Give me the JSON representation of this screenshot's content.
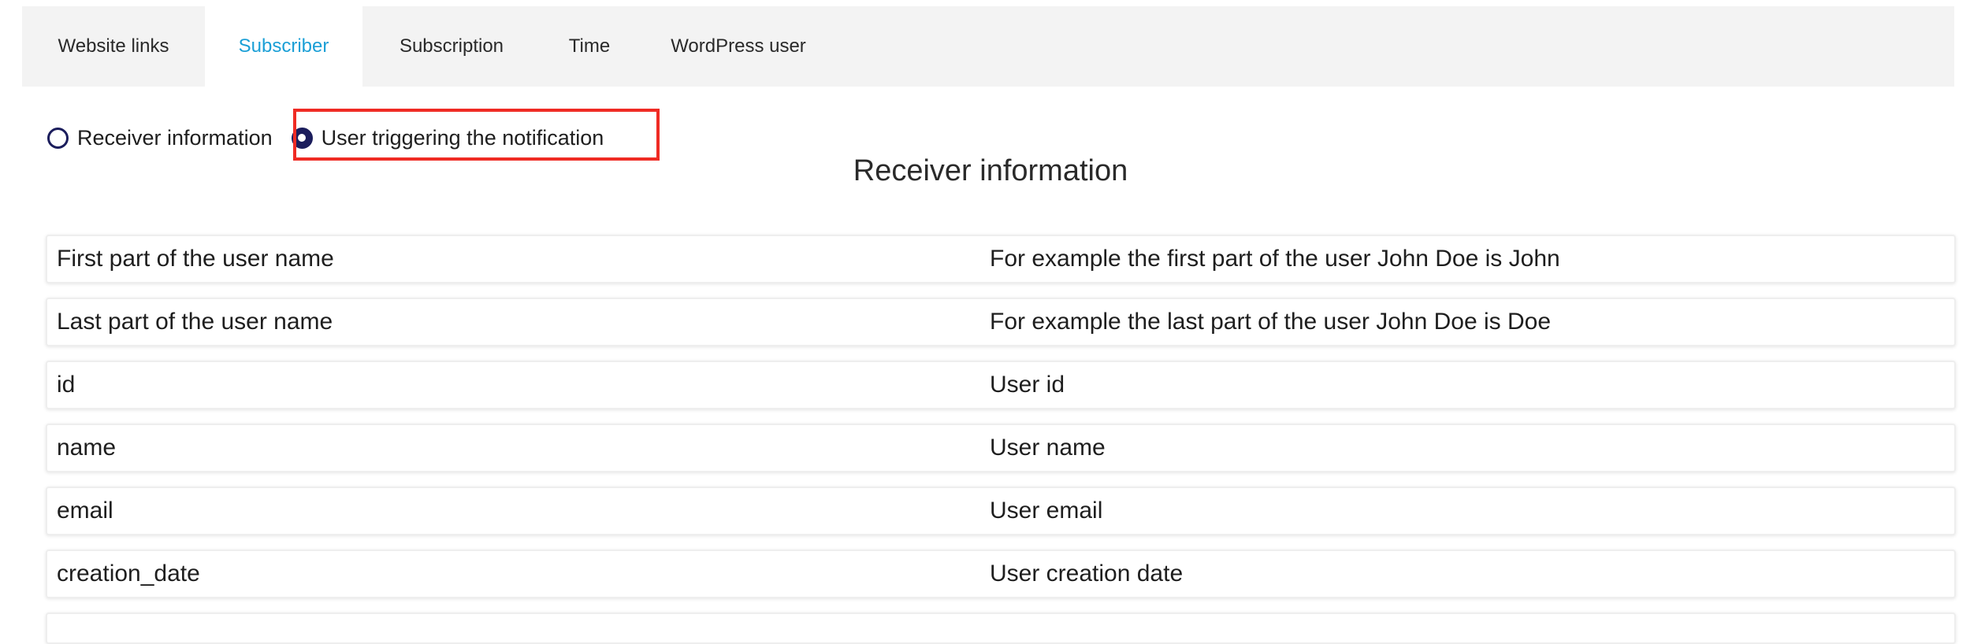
{
  "tabs": [
    {
      "label": "Website links",
      "active": false
    },
    {
      "label": "Subscriber",
      "active": true
    },
    {
      "label": "Subscription",
      "active": false
    },
    {
      "label": "Time",
      "active": false
    },
    {
      "label": "WordPress user",
      "active": false
    }
  ],
  "radio_group": {
    "options": [
      {
        "label": "Receiver information",
        "checked": false
      },
      {
        "label": "User triggering the notification",
        "checked": true
      }
    ]
  },
  "section_title": "Receiver information",
  "rows": [
    {
      "key": "First part of the user name",
      "description": "For example the first part of the user John Doe is John"
    },
    {
      "key": "Last part of the user name",
      "description": "For example the last part of the user John Doe is Doe"
    },
    {
      "key": "id",
      "description": "User id"
    },
    {
      "key": "name",
      "description": "User name"
    },
    {
      "key": "email",
      "description": "User email"
    },
    {
      "key": "creation_date",
      "description": "User creation date"
    }
  ],
  "colors": {
    "active_tab": "#1a9fd6",
    "radio": "#1b1d5c",
    "highlight": "#ef2b24",
    "tabbar_bg": "#f3f3f3"
  }
}
